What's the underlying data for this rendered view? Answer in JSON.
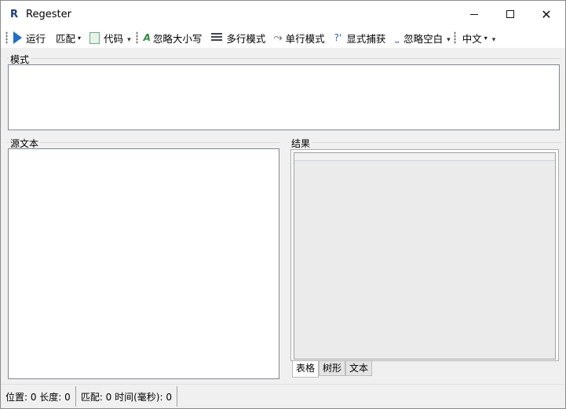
{
  "window": {
    "app_icon": "R",
    "title": "Regester",
    "minimize_icon": "minimize-icon",
    "maximize_icon": "maximize-icon",
    "close_icon": "close-icon",
    "close_glyph": "✕"
  },
  "toolbar": {
    "run_label": "运行",
    "match_combo": "匹配",
    "code_label": "代码",
    "ignore_case_label": "忽略大小写",
    "multiline_label": "多行模式",
    "singleline_label": "单行模式",
    "explicit_capture_label": "显式捕获",
    "ignore_whitespace_label": "忽略空白",
    "language_combo": "中文",
    "dropdown_arrow": "▾",
    "overflow_arrow": "▾",
    "icons": {
      "run": "play-icon",
      "code": "code-file-icon",
      "ignore_case": "ai-case-icon",
      "multiline": "list-icon",
      "singleline": "single-line-icon",
      "explicit_capture": "question-icon",
      "ignore_whitespace": "space-icon"
    },
    "q_glyph": "?'",
    "space_glyph": "⎵",
    "single_glyph": "⤳",
    "ai_glyph": "A"
  },
  "pattern": {
    "label": "模式",
    "value": ""
  },
  "source": {
    "label": "源文本",
    "value": ""
  },
  "result": {
    "label": "结果",
    "tabs": [
      "表格",
      "树形",
      "文本"
    ],
    "active_tab": "表格"
  },
  "status": {
    "position": "位置: 0 长度: 0",
    "match": "匹配: 0 时间(毫秒): 0"
  },
  "colors": {
    "accent": "#1c6fd0",
    "window_bg": "#f0f0f0",
    "grid_bg": "#ebebeb"
  }
}
